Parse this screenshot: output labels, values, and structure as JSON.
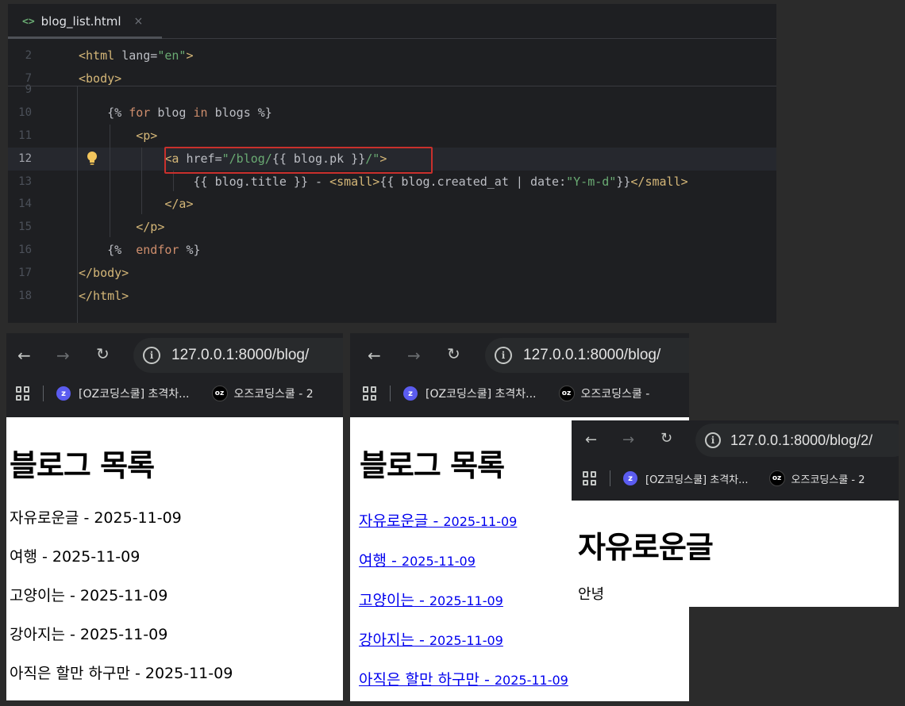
{
  "editor": {
    "tab_icon": "<>",
    "tab_name": "blog_list.html",
    "tab_close": "×",
    "lines": [
      {
        "n": "2",
        "indent": "",
        "tokens": [
          [
            "tag",
            "<html "
          ],
          [
            "attr",
            "lang="
          ],
          [
            "str",
            "\"en\""
          ],
          [
            "tag",
            ">"
          ]
        ]
      },
      {
        "n": "7",
        "indent": "",
        "tokens": [
          [
            "tag",
            "<body>"
          ]
        ]
      },
      {
        "n": "9",
        "indent": "",
        "tokens": []
      },
      {
        "n": "10",
        "indent": "    ",
        "tokens": [
          [
            "txt",
            "{% "
          ],
          [
            "kw",
            "for "
          ],
          [
            "txt",
            "blog "
          ],
          [
            "kw",
            "in "
          ],
          [
            "txt",
            "blogs %}"
          ]
        ]
      },
      {
        "n": "11",
        "indent": "        ",
        "tokens": [
          [
            "tag",
            "<p>"
          ]
        ]
      },
      {
        "n": "12",
        "indent": "            ",
        "tokens": [
          [
            "tag",
            "<a "
          ],
          [
            "attr",
            "href="
          ],
          [
            "str",
            "\"/blog/"
          ],
          [
            "txt",
            "{{ blog.pk }}"
          ],
          [
            "str",
            "/\""
          ],
          [
            "tag",
            ">"
          ]
        ]
      },
      {
        "n": "13",
        "indent": "                ",
        "tokens": [
          [
            "txt",
            "{{ blog.title }} - "
          ],
          [
            "tag",
            "<small>"
          ],
          [
            "txt",
            "{{ blog.created_at | date:"
          ],
          [
            "str",
            "\"Y-m-d\""
          ],
          [
            "txt",
            "}}"
          ],
          [
            "tag",
            "</small>"
          ]
        ]
      },
      {
        "n": "14",
        "indent": "            ",
        "tokens": [
          [
            "tag",
            "</a>"
          ]
        ]
      },
      {
        "n": "15",
        "indent": "        ",
        "tokens": [
          [
            "tag",
            "</p>"
          ]
        ]
      },
      {
        "n": "16",
        "indent": "    ",
        "tokens": [
          [
            "txt",
            "{%  "
          ],
          [
            "kw",
            "endfor "
          ],
          [
            "txt",
            "%}"
          ]
        ]
      },
      {
        "n": "17",
        "indent": "",
        "tokens": [
          [
            "tag",
            "</body>"
          ]
        ]
      },
      {
        "n": "18",
        "indent": "",
        "tokens": [
          [
            "tag",
            "</html>"
          ]
        ]
      }
    ]
  },
  "browser_common": {
    "url_list": "127.0.0.1:8000/blog/",
    "url_detail": "127.0.0.1:8000/blog/2/",
    "bookmark_1": "[OZ코딩스쿨] 초격차...",
    "bookmark_2_short": "오즈코딩스쿨 - 2",
    "bookmark_2": "오즈코딩스쿨 -",
    "bookmark_2b": "오즈코딩스쿨 - 2",
    "z_icon": "z",
    "oz_icon": "oz"
  },
  "list_page": {
    "heading": "블로그 목록",
    "items": [
      {
        "title": "자유로운글",
        "date": "2025-11-09"
      },
      {
        "title": "여행",
        "date": "2025-11-09"
      },
      {
        "title": "고양이는",
        "date": "2025-11-09"
      },
      {
        "title": "강아지는",
        "date": "2025-11-09"
      },
      {
        "title": "아직은 할만 하구만",
        "date": "2025-11-09"
      }
    ]
  },
  "detail_page": {
    "heading": "자유로운글",
    "body": "안녕"
  },
  "colors": {
    "link": "#0000ee",
    "highlight_box": "#c9302c",
    "editor_bg": "#1e1f22"
  }
}
